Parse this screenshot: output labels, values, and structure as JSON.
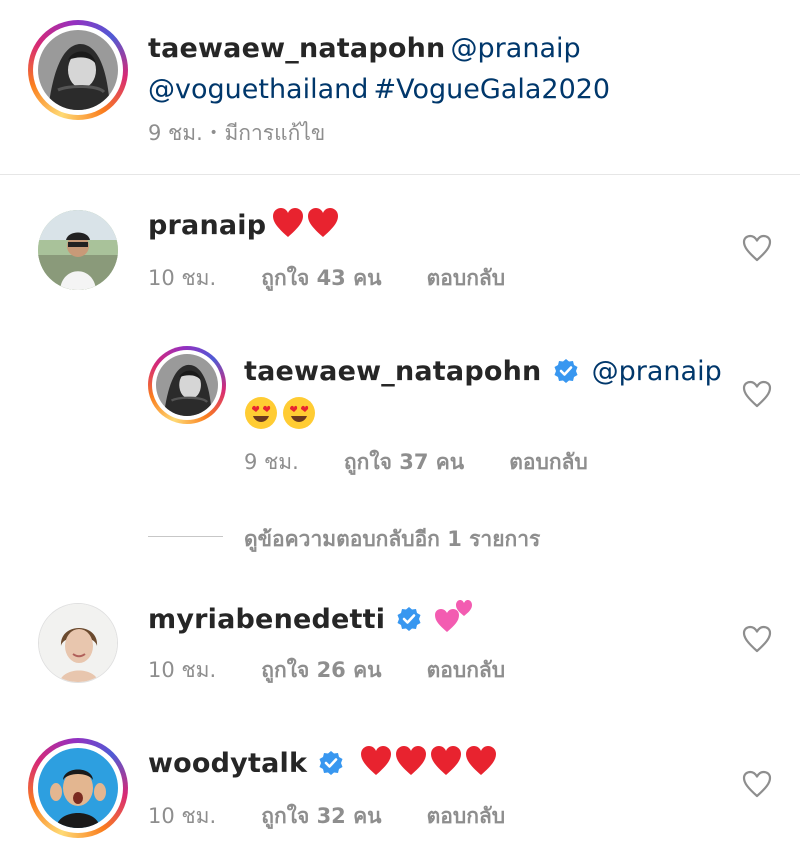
{
  "caption": {
    "username": "taewaew_natapohn",
    "mention1": "@pranaip",
    "mention2": "@voguethailand",
    "hashtag": "#VogueGala2020",
    "time": "9 ชม.",
    "separator": "•",
    "edited": "มีการแก้ไข"
  },
  "comments": [
    {
      "username": "pranaip",
      "verified": false,
      "emoji": "❤️❤️",
      "time": "10 ชม.",
      "likes": "ถูกใจ 43 คน",
      "reply": "ตอบกลับ"
    },
    {
      "username": "myriabenedetti",
      "verified": true,
      "emoji": "💕",
      "time": "10 ชม.",
      "likes": "ถูกใจ 26 คน",
      "reply": "ตอบกลับ"
    },
    {
      "username": "woodytalk",
      "verified": true,
      "emoji": "❤️❤️❤️❤️",
      "time": "10 ชม.",
      "likes": "ถูกใจ 32 คน",
      "reply": "ตอบกลับ"
    }
  ],
  "reply": {
    "username": "taewaew_natapohn",
    "verified": true,
    "mention": "@pranaip",
    "emoji": "😍😍",
    "time": "9 ชม.",
    "likes": "ถูกใจ 37 คน",
    "reply": "ตอบกลับ"
  },
  "view_more_replies": "ดูข้อความตอบกลับอีก 1 รายการ",
  "colors": {
    "mention": "#00376b",
    "verified": "#3897f0",
    "heart": "#ed4956",
    "meta": "#8e8e8e"
  }
}
